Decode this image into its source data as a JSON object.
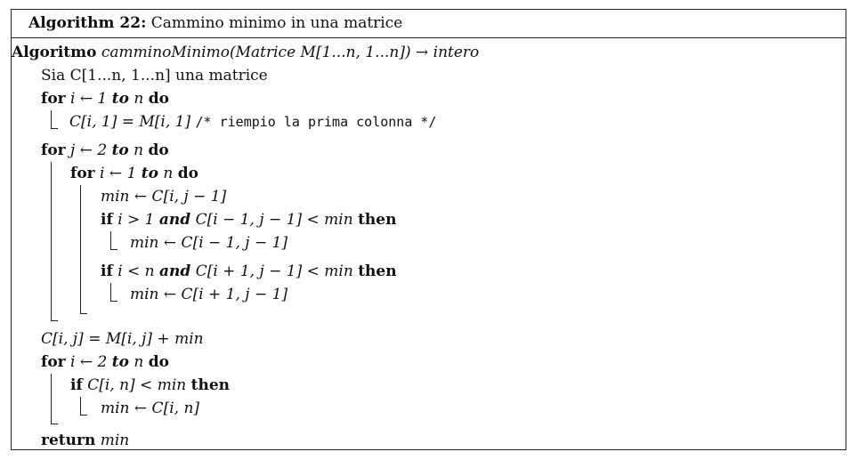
{
  "caption": {
    "label": "Algorithm 22:",
    "title": "Cammino minimo in una matrice"
  },
  "lines": {
    "header_kw": "Algoritmo",
    "header_sig": "camminoMinimo(Matrice M[1...n, 1...n]) → intero",
    "sia": "Sia C[1...n, 1...n] una matrice",
    "for1_kw1": "for",
    "for1_mid": "i ← 1",
    "for1_kw2": "to",
    "for1_n": "n",
    "for1_kw3": "do",
    "init_math": "C[i, 1] = M[i, 1]",
    "init_comment": "/* riempio la prima colonna */",
    "for2_kw1": "for",
    "for2_mid": "j ← 2",
    "for2_kw2": "to",
    "for2_n": "n",
    "for2_kw3": "do",
    "for3_kw1": "for",
    "for3_mid": "i ← 1",
    "for3_kw2": "to",
    "for3_n": "n",
    "for3_kw3": "do",
    "min_assign": "min ← C[i, j − 1]",
    "if1_kw": "if",
    "if1_a": "i > 1",
    "if1_and": "and",
    "if1_b": "C[i − 1, j − 1] < min",
    "if1_then": "then",
    "if1_body": "min ← C[i − 1, j − 1]",
    "if2_kw": "if",
    "if2_a": "i < n",
    "if2_and": "and",
    "if2_b": "C[i + 1, j − 1] < min",
    "if2_then": "then",
    "if2_body": "min ← C[i + 1, j − 1]",
    "cij": "C[i, j] = M[i, j] + min",
    "for4_kw1": "for",
    "for4_mid": "i ← 2",
    "for4_kw2": "to",
    "for4_n": "n",
    "for4_kw3": "do",
    "if3_kw": "if",
    "if3_cond": "C[i, n] < min",
    "if3_then": "then",
    "if3_body": "min ← C[i, n]",
    "ret_kw": "return",
    "ret_val": "min"
  }
}
